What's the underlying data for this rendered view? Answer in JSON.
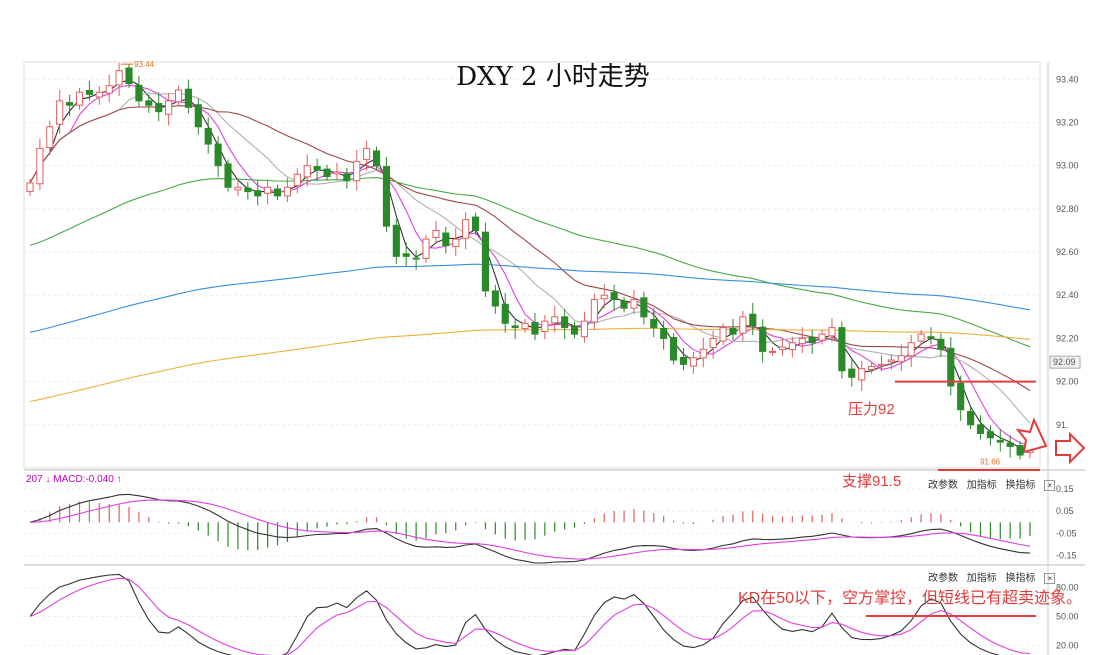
{
  "title": "DXY 2 小时走势",
  "annotations": {
    "resistance": "压力92",
    "support": "支撑91.5",
    "kd_note": "KD在50以下，空方掌控，但短线已有超卖迹象。",
    "high_marker": "93.44",
    "low_marker": "91.66"
  },
  "macd_label": "207 ↓ MACD:-0.040 ↑",
  "toolbars": {
    "macd": [
      "改参数",
      "加指标",
      "换指标"
    ],
    "kd": [
      "改参数",
      "加指标",
      "换指标"
    ]
  },
  "last_price_tag": "92.09",
  "colors": {
    "up": "#e06060",
    "down": "#2a8a2a",
    "ma_black": "#333333",
    "ma_magenta": "#e040e0",
    "ma_gray": "#b0b0b0",
    "ma_brown": "#a04848",
    "ma_green": "#4aa84a",
    "ma_blue": "#3a8ee0",
    "ma_orange": "#f0b040",
    "annotation": "#e03c3c"
  },
  "chart_data": [
    {
      "type": "candlestick",
      "title": "DXY 2 小时走势",
      "ylim": [
        91.6,
        93.48
      ],
      "yticks": [
        "93.40",
        "93.20",
        "93.00",
        "92.80",
        "92.60",
        "92.40",
        "92.20",
        "92.00",
        "91."
      ],
      "close": [
        92.92,
        93.08,
        93.18,
        93.3,
        93.28,
        93.34,
        93.33,
        93.34,
        93.37,
        93.44,
        93.38,
        93.3,
        93.28,
        93.25,
        93.3,
        93.35,
        93.27,
        93.18,
        93.1,
        93.0,
        92.9,
        92.9,
        92.88,
        92.86,
        92.9,
        92.86,
        92.9,
        92.96,
        93.0,
        92.98,
        92.95,
        92.97,
        92.93,
        93.02,
        93.08,
        93.0,
        92.72,
        92.58,
        92.58,
        92.57,
        92.66,
        92.7,
        92.63,
        92.66,
        92.75,
        92.7,
        92.42,
        92.35,
        92.27,
        92.25,
        92.27,
        92.22,
        92.28,
        92.3,
        92.25,
        92.22,
        92.28,
        92.38,
        92.4,
        92.38,
        92.34,
        92.38,
        92.3,
        92.25,
        92.2,
        92.1,
        92.08,
        92.11,
        92.15,
        92.2,
        92.25,
        92.22,
        92.3,
        92.26,
        92.14,
        92.14,
        92.16,
        92.18,
        92.2,
        92.18,
        92.22,
        92.25,
        92.05,
        92.02,
        92.06,
        92.07,
        92.08,
        92.1,
        92.12,
        92.18,
        92.22,
        92.2,
        92.15,
        91.98,
        91.87,
        91.8,
        91.76,
        91.74,
        91.72,
        91.7,
        91.66,
        91.7
      ],
      "highs_marked": {
        "value": 93.44,
        "label": "93.44"
      },
      "lows_marked": {
        "value": 91.66,
        "label": "91.66"
      },
      "levels": [
        {
          "name": "压力92",
          "value": 92.0
        },
        {
          "name": "支撑91.5",
          "value": 91.5
        }
      ]
    },
    {
      "type": "line",
      "title": "MACD",
      "value_label": "MACD:-0.040",
      "yticks": [
        "0.15",
        "0.05",
        "-0.05",
        "-0.15"
      ],
      "ylim": [
        -0.17,
        0.2
      ]
    },
    {
      "type": "line",
      "title": "KD",
      "yticks": [
        "80.00",
        "50.00",
        "20.00"
      ],
      "ylim": [
        10,
        90
      ]
    }
  ]
}
